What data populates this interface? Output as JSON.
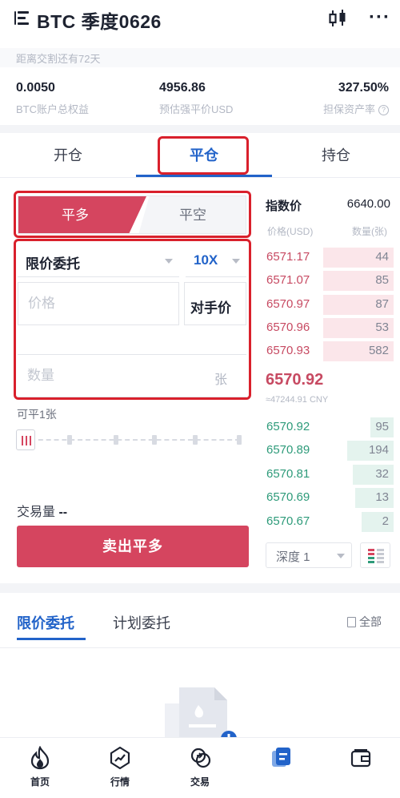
{
  "header": {
    "title": "BTC 季度0626",
    "delivery_note": "距离交割还有72天"
  },
  "stats": [
    {
      "value": "0.0050",
      "label": "BTC账户总权益"
    },
    {
      "value": "4956.86",
      "label": "预估强平价USD"
    },
    {
      "value": "327.50%",
      "label": "担保资产率"
    }
  ],
  "tabs": [
    {
      "label": "开仓",
      "active": false
    },
    {
      "label": "平仓",
      "active": true
    },
    {
      "label": "持仓",
      "active": false
    }
  ],
  "side_toggle": {
    "close_long": "平多",
    "close_short": "平空",
    "selected": "平多"
  },
  "form": {
    "order_type": "限价委托",
    "leverage": "10X",
    "price_placeholder": "价格",
    "counterparty_price": "对手价",
    "amount_placeholder": "数量",
    "amount_unit": "张",
    "available": "可平1张",
    "slider_percent": 0,
    "volume_label": "交易量",
    "volume_value": "--",
    "submit_label": "卖出平多"
  },
  "order_book": {
    "index_label": "指数价",
    "index_value": "6640.00",
    "col_price": "价格(USD)",
    "col_qty": "数量(张)",
    "asks": [
      {
        "price": "6571.17",
        "qty": "44",
        "depth": 0.55
      },
      {
        "price": "6571.07",
        "qty": "85",
        "depth": 0.55
      },
      {
        "price": "6570.97",
        "qty": "87",
        "depth": 0.55
      },
      {
        "price": "6570.96",
        "qty": "53",
        "depth": 0.55
      },
      {
        "price": "6570.93",
        "qty": "582",
        "depth": 0.55
      }
    ],
    "last_price": "6570.92",
    "last_cny": "≈47244.91 CNY",
    "bids": [
      {
        "price": "6570.92",
        "qty": "95",
        "depth": 0.18
      },
      {
        "price": "6570.89",
        "qty": "194",
        "depth": 0.36
      },
      {
        "price": "6570.81",
        "qty": "32",
        "depth": 0.32
      },
      {
        "price": "6570.69",
        "qty": "13",
        "depth": 0.3
      },
      {
        "price": "6570.67",
        "qty": "2",
        "depth": 0.25
      }
    ],
    "depth_select": "深度 1"
  },
  "orders": {
    "tabs": [
      {
        "label": "限价委托",
        "active": true
      },
      {
        "label": "计划委托",
        "active": false
      }
    ],
    "all_label": "全部"
  },
  "bottom_nav": [
    {
      "label": "首页",
      "icon": "flame-icon"
    },
    {
      "label": "行情",
      "icon": "market-icon"
    },
    {
      "label": "交易",
      "icon": "exchange-icon"
    },
    {
      "label": "",
      "icon": "contract-icon",
      "active": true
    },
    {
      "label": "",
      "icon": "wallet-icon"
    }
  ],
  "colors": {
    "accent": "#2263c9",
    "sell": "#d5455f",
    "buy": "#2e9b7a",
    "highlight": "#d9202c"
  }
}
